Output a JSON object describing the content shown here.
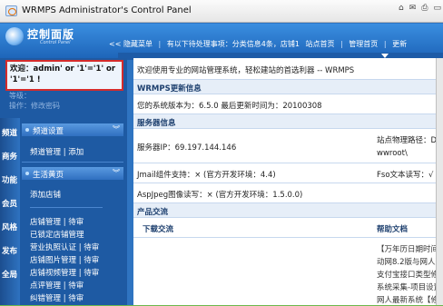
{
  "window": {
    "title": "WRMPS Administrator's Control Panel"
  },
  "header": {
    "logo_text": "控制面版",
    "logo_sub": "Control Panel",
    "nav": [
      "<< 隐藏菜单",
      "|",
      "有以下待处理事项：分类信息4条，店铺1",
      "站点首页",
      "|",
      "管理首页",
      "|",
      "更新"
    ]
  },
  "user": {
    "line1": "欢迎：admin' or '1'='1' or",
    "line2": "'1'='1 !",
    "faint1": "等级：",
    "faint2": "操作：修改密码"
  },
  "sidebar": {
    "labels": [
      "频道",
      "商务",
      "功能",
      "会员",
      "风格",
      "发布",
      "全局"
    ],
    "group1": "频道设置",
    "group1_link": "频道管理 | 添加",
    "group2": "生活黄页",
    "group2_links": [
      "添加店铺",
      "店铺管理 | 待审",
      "已锁定店铺管理",
      "营业执照认证 | 待审",
      "店铺图片管理 | 待审",
      "店铺视频管理 | 待审",
      "点评管理 | 待审",
      "纠错管理 | 待审"
    ]
  },
  "main": {
    "welcome": "欢迎使用专业的网站管理系统，轻松建站的首选利器 -- WRMPS",
    "update_head": "WRMPS更新信息",
    "version_line": "您的系统版本为：6.5.0    最后更新时间为：20100308",
    "server_head": "服务器信息",
    "server_ip": "服务器IP：69.197.144.146",
    "site_path_label": "站点物理路径：D:",
    "site_path_value": "wwroot\\",
    "jmail": "Jmail组件支持：× (官方开发环境：4.4)",
    "fso": "Fso文本读写：√",
    "aspjpeg": "AspJpeg图像读写：× (官方开发环境：1.5.0.0)",
    "product_head": "产品交流",
    "download_head": "下载交流",
    "help_head": "帮助文档",
    "help_items": [
      "【万年历日期时间",
      "动网8.2版与网人整",
      "支付宝接口类型修",
      "系统采集-项目设置",
      "网人最新系统【修"
    ]
  },
  "tools": {
    "home": "⌂",
    "feeds": "✉",
    "print": "⎙",
    "page": "▭"
  }
}
